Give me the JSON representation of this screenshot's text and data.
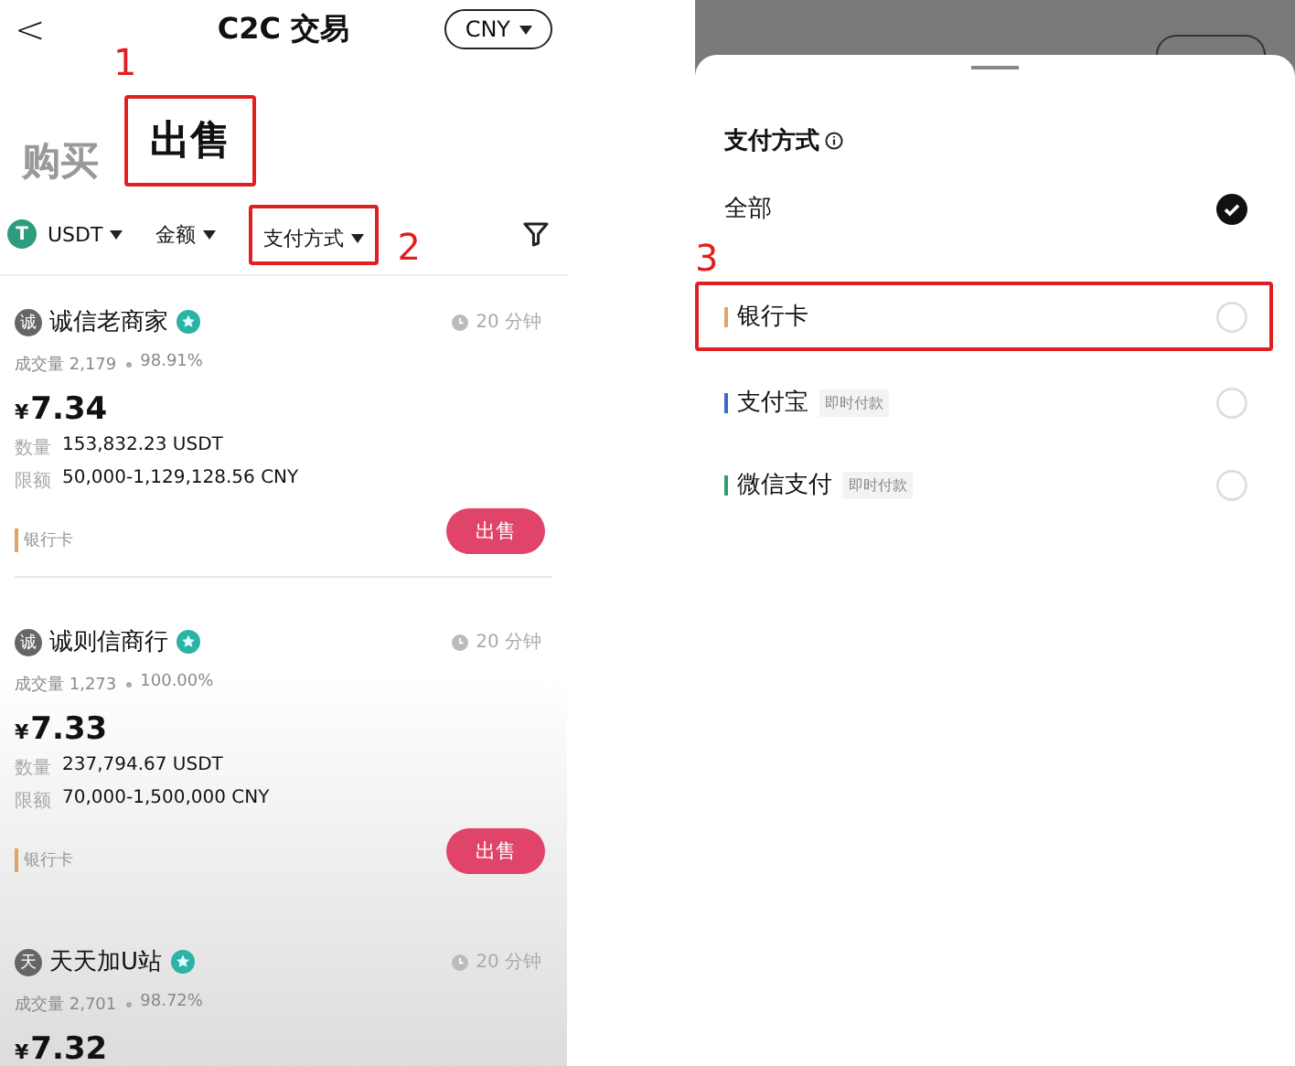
{
  "left_screen": {
    "header": {
      "back": "<",
      "title": "C2C 交易",
      "currency": "CNY"
    },
    "tabs": [
      {
        "label": "购买",
        "selected": false
      },
      {
        "label": "出售",
        "selected": true,
        "annotation": "1"
      }
    ],
    "filters": [
      {
        "kind": "coin",
        "label": "USDT",
        "icon_text": "T"
      },
      {
        "kind": "plain",
        "label": "金额"
      },
      {
        "kind": "plain",
        "label": "支付方式",
        "annotation": "2"
      }
    ],
    "offers": [
      {
        "avatar": "诚",
        "name": "诚信老商家",
        "time": "20 分钟",
        "volume": "成交量 2,179",
        "rate": "98.91%",
        "currency_sign": "¥",
        "price": "7.34",
        "quantity_label": "数量",
        "quantity": "153,832.23 USDT",
        "limit_label": "限额",
        "limit": "50,000-1,129,128.56 CNY",
        "payment": "银行卡",
        "action": "出售"
      },
      {
        "avatar": "诚",
        "name": "诚则信商行",
        "time": "20 分钟",
        "volume": "成交量 1,273",
        "rate": "100.00%",
        "currency_sign": "¥",
        "price": "7.33",
        "quantity_label": "数量",
        "quantity": "237,794.67 USDT",
        "limit_label": "限额",
        "limit": "70,000-1,500,000 CNY",
        "payment": "银行卡",
        "action": "出售"
      },
      {
        "avatar": "天",
        "name": "天天加U站",
        "time": "20 分钟",
        "volume": "成交量 2,701",
        "rate": "98.72%",
        "currency_sign": "¥",
        "price": "7.32"
      }
    ]
  },
  "right_screen": {
    "sheet": {
      "title": "支付方式",
      "options": [
        {
          "label": "全部",
          "selected": true
        },
        {
          "label": "银行卡",
          "selected": false,
          "color": "#e0a565",
          "annotation": "3"
        },
        {
          "label": "支付宝",
          "selected": false,
          "color": "#3a6cc4",
          "tag": "即时付款"
        },
        {
          "label": "微信支付",
          "selected": false,
          "color": "#2f9e6e",
          "tag": "即时付款"
        }
      ]
    }
  }
}
